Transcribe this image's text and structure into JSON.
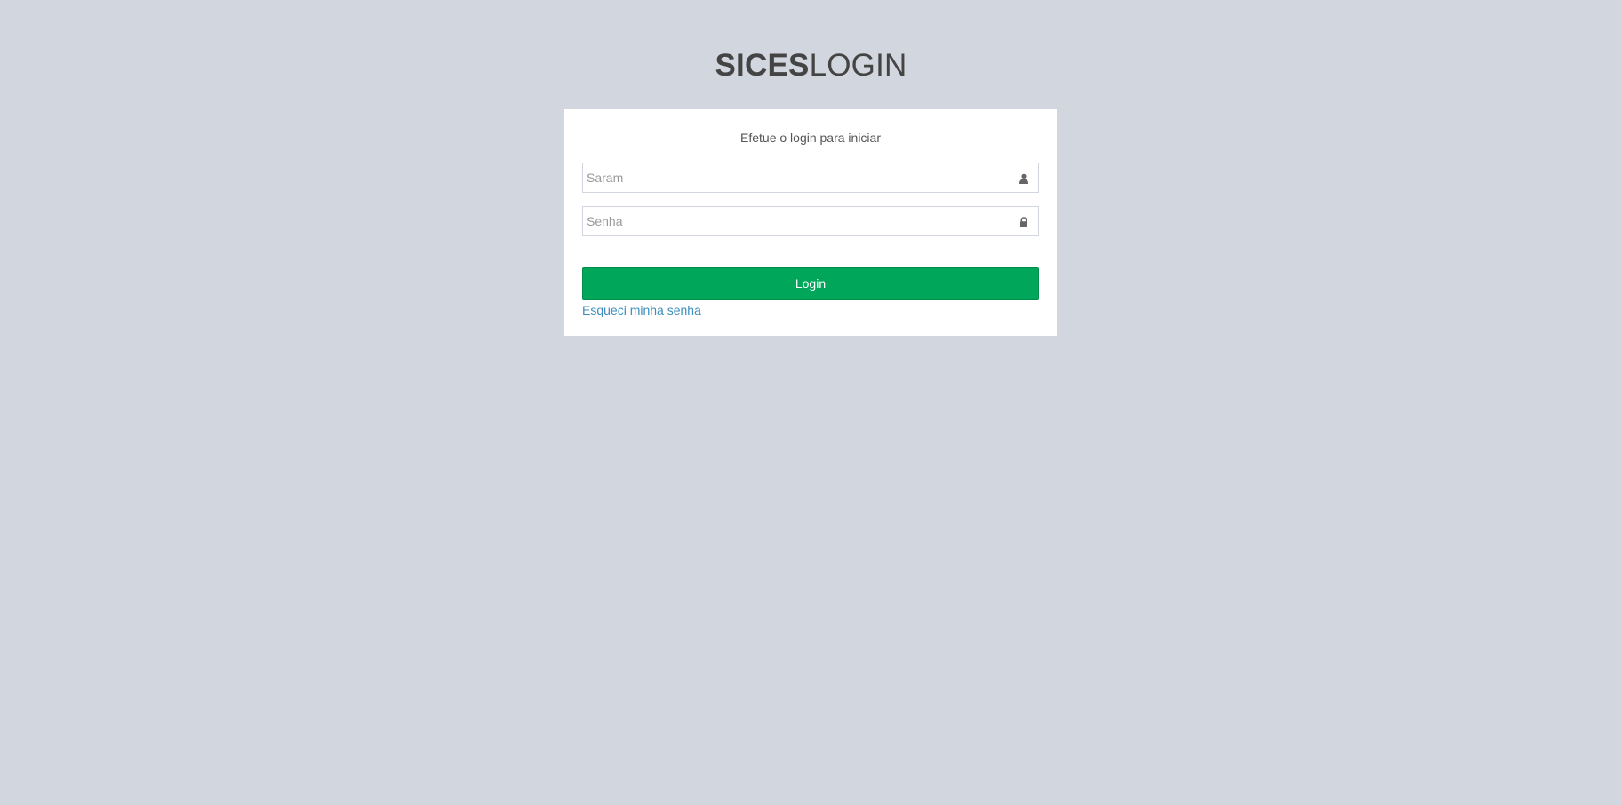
{
  "logo": {
    "bold": "SICES",
    "light": "LOGIN"
  },
  "login": {
    "message": "Efetue o login para iniciar",
    "username_placeholder": "Saram",
    "username_icon": "user-icon",
    "password_placeholder": "Senha",
    "password_icon": "lock-icon",
    "button_label": "Login",
    "forgot_link": "Esqueci minha senha"
  },
  "colors": {
    "background": "#d2d6de",
    "button": "#00a65a",
    "link": "#3c8dbc"
  }
}
